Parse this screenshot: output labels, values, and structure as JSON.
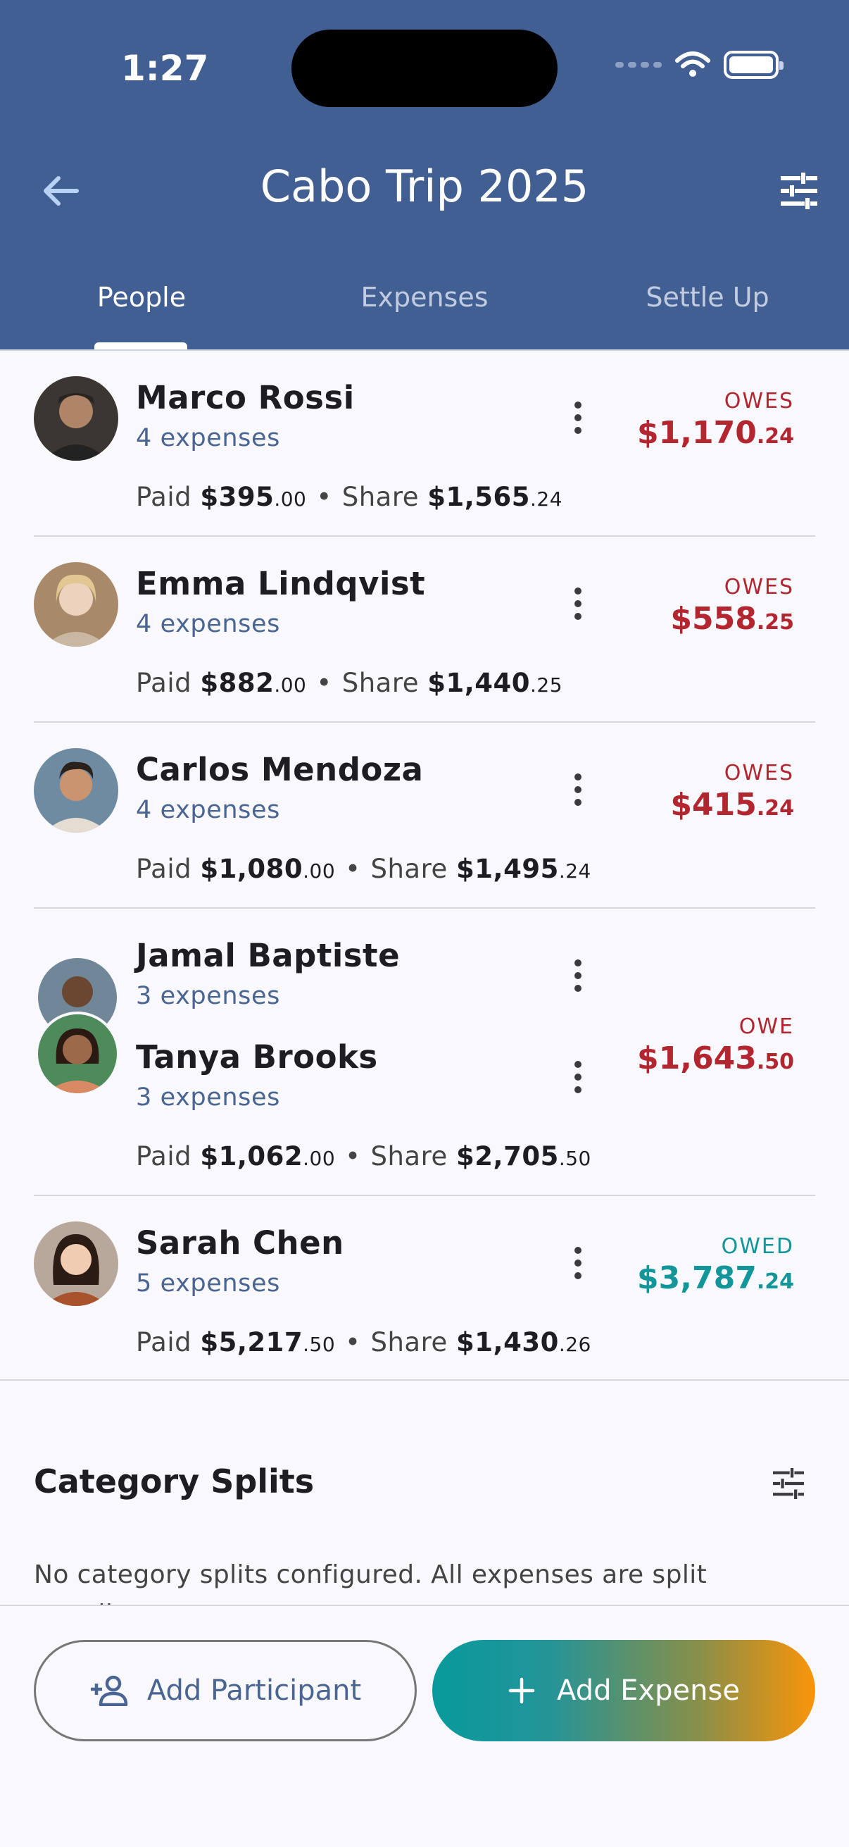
{
  "status": {
    "time": "1:27"
  },
  "header": {
    "title": "Cabo Trip 2025"
  },
  "tabs": [
    {
      "label": "People"
    },
    {
      "label": "Expenses"
    },
    {
      "label": "Settle Up"
    }
  ],
  "people": [
    {
      "names": [
        "Marco Rossi"
      ],
      "subs": [
        "4 expenses"
      ],
      "status": "OWES",
      "amount_main": "$1,170",
      "amount_cents": ".24",
      "paid_label": "Paid",
      "paid_main": "$395",
      "paid_cents": ".00",
      "share_label": "Share",
      "share_main": "$1,565",
      "share_cents": ".24"
    },
    {
      "names": [
        "Emma Lindqvist"
      ],
      "subs": [
        "4 expenses"
      ],
      "status": "OWES",
      "amount_main": "$558",
      "amount_cents": ".25",
      "paid_label": "Paid",
      "paid_main": "$882",
      "paid_cents": ".00",
      "share_label": "Share",
      "share_main": "$1,440",
      "share_cents": ".25"
    },
    {
      "names": [
        "Carlos Mendoza"
      ],
      "subs": [
        "4 expenses"
      ],
      "status": "OWES",
      "amount_main": "$415",
      "amount_cents": ".24",
      "paid_label": "Paid",
      "paid_main": "$1,080",
      "paid_cents": ".00",
      "share_label": "Share",
      "share_main": "$1,495",
      "share_cents": ".24"
    },
    {
      "names": [
        "Jamal Baptiste",
        "Tanya Brooks"
      ],
      "subs": [
        "3 expenses",
        "3 expenses"
      ],
      "status": "OWE",
      "amount_main": "$1,643",
      "amount_cents": ".50",
      "paid_label": "Paid",
      "paid_main": "$1,062",
      "paid_cents": ".00",
      "share_label": "Share",
      "share_main": "$2,705",
      "share_cents": ".50"
    },
    {
      "names": [
        "Sarah Chen"
      ],
      "subs": [
        "5 expenses"
      ],
      "status": "OWED",
      "amount_main": "$3,787",
      "amount_cents": ".24",
      "paid_label": "Paid",
      "paid_main": "$5,217",
      "paid_cents": ".50",
      "share_label": "Share",
      "share_main": "$1,430",
      "share_cents": ".26"
    }
  ],
  "category": {
    "title": "Category Splits",
    "note": "No category splits configured. All expenses are split equally."
  },
  "actions": {
    "add_participant": "Add Participant",
    "add_expense": "Add Expense"
  },
  "colors": {
    "header": "#425f93",
    "owes": "#b3262f",
    "owed": "#13969a",
    "link": "#4a6591",
    "gradient_start": "#089a9c",
    "gradient_end": "#fa9409"
  },
  "icons": {
    "back": "arrow-left-icon",
    "tune": "tune-icon",
    "more": "more-vertical-icon",
    "add_person": "person-add-icon",
    "add": "plus-icon"
  }
}
